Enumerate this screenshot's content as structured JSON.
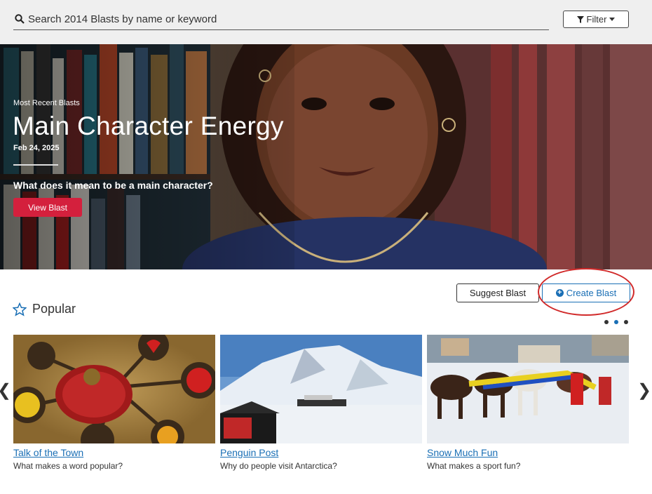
{
  "search": {
    "placeholder": "Search 2014 Blasts by name or keyword"
  },
  "filter": {
    "label": "Filter"
  },
  "hero": {
    "kicker": "Most Recent Blasts",
    "title": "Main Character Energy",
    "date": "Feb 24, 2025",
    "question": "What does it mean to be a main character?",
    "button": "View Blast"
  },
  "actions": {
    "suggest": "Suggest Blast",
    "create": "Create Blast"
  },
  "section": {
    "title": "Popular"
  },
  "cards": [
    {
      "title": "Talk of the Town",
      "subtitle": "What makes a word popular?",
      "image": "brain-emoji-network"
    },
    {
      "title": "Penguin Post",
      "subtitle": "Why do people visit Antarctica?",
      "image": "antarctica-ship-mountains"
    },
    {
      "title": "Snow Much Fun",
      "subtitle": "What makes a sport fun?",
      "image": "horse-skijoring-race"
    }
  ],
  "carousel": {
    "pages": 3,
    "active": 2
  },
  "colors": {
    "accent": "#1a6fb5",
    "primary_button": "#d4203d",
    "annotation": "#d12a2a"
  }
}
